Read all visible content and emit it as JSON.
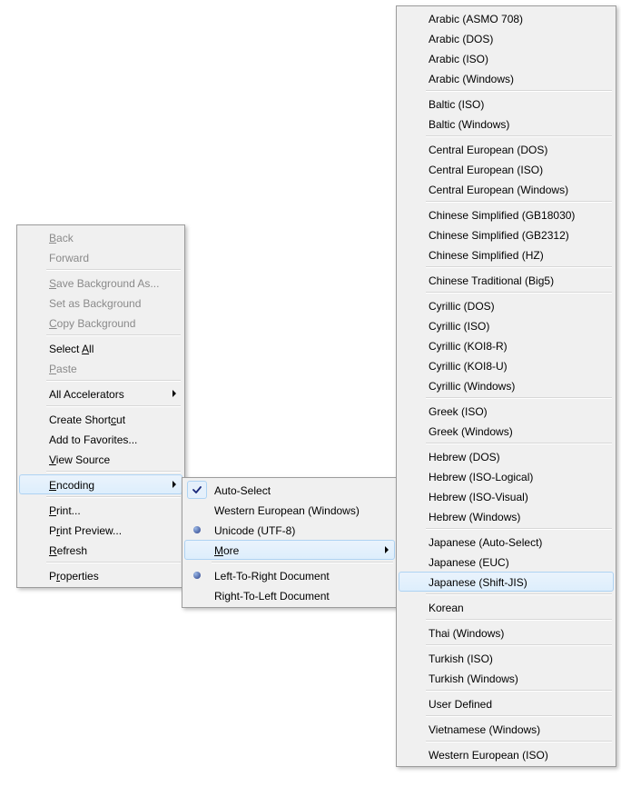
{
  "menu1": {
    "groups": [
      [
        {
          "label": "Back",
          "disabled": true,
          "u": 0
        },
        {
          "label": "Forward",
          "disabled": true
        }
      ],
      [
        {
          "label": "Save Background As...",
          "disabled": true,
          "u": 0
        },
        {
          "label": "Set as Background",
          "disabled": true
        },
        {
          "label": "Copy Background",
          "disabled": true,
          "u": 0
        }
      ],
      [
        {
          "label": "Select All",
          "u": 7
        },
        {
          "label": "Paste",
          "disabled": true,
          "u": 0
        }
      ],
      [
        {
          "label": "All Accelerators",
          "submenu": true
        }
      ],
      [
        {
          "label": "Create Shortcut",
          "u": 12
        },
        {
          "label": "Add to Favorites..."
        },
        {
          "label": "View Source",
          "u": 0
        }
      ],
      [
        {
          "label": "Encoding",
          "submenu": true,
          "highlight": true,
          "u": 0
        }
      ],
      [
        {
          "label": "Print...",
          "u": 0
        },
        {
          "label": "Print Preview...",
          "u": 1
        },
        {
          "label": "Refresh",
          "u": 0
        }
      ],
      [
        {
          "label": "Properties",
          "u": 1
        }
      ]
    ]
  },
  "menu2": {
    "groups": [
      [
        {
          "label": "Auto-Select",
          "check": true
        },
        {
          "label": "Western European (Windows)"
        },
        {
          "label": "Unicode (UTF-8)",
          "radio": true
        },
        {
          "label": "More",
          "submenu": true,
          "highlight": true,
          "u": 0
        }
      ],
      [
        {
          "label": "Left-To-Right Document",
          "radio": true
        },
        {
          "label": "Right-To-Left Document"
        }
      ]
    ]
  },
  "menu3": {
    "groups": [
      [
        {
          "label": "Arabic (ASMO 708)"
        },
        {
          "label": "Arabic (DOS)"
        },
        {
          "label": "Arabic (ISO)"
        },
        {
          "label": "Arabic (Windows)"
        }
      ],
      [
        {
          "label": "Baltic (ISO)"
        },
        {
          "label": "Baltic (Windows)"
        }
      ],
      [
        {
          "label": "Central European (DOS)"
        },
        {
          "label": "Central European (ISO)"
        },
        {
          "label": "Central European (Windows)"
        }
      ],
      [
        {
          "label": "Chinese Simplified (GB18030)"
        },
        {
          "label": "Chinese Simplified (GB2312)"
        },
        {
          "label": "Chinese Simplified (HZ)"
        }
      ],
      [
        {
          "label": "Chinese Traditional (Big5)"
        }
      ],
      [
        {
          "label": "Cyrillic (DOS)"
        },
        {
          "label": "Cyrillic (ISO)"
        },
        {
          "label": "Cyrillic (KOI8-R)"
        },
        {
          "label": "Cyrillic (KOI8-U)"
        },
        {
          "label": "Cyrillic (Windows)"
        }
      ],
      [
        {
          "label": "Greek (ISO)"
        },
        {
          "label": "Greek (Windows)"
        }
      ],
      [
        {
          "label": "Hebrew (DOS)"
        },
        {
          "label": "Hebrew (ISO-Logical)"
        },
        {
          "label": "Hebrew (ISO-Visual)"
        },
        {
          "label": "Hebrew (Windows)"
        }
      ],
      [
        {
          "label": "Japanese (Auto-Select)"
        },
        {
          "label": "Japanese (EUC)"
        },
        {
          "label": "Japanese (Shift-JIS)",
          "highlight": true
        }
      ],
      [
        {
          "label": "Korean"
        }
      ],
      [
        {
          "label": "Thai (Windows)"
        }
      ],
      [
        {
          "label": "Turkish (ISO)"
        },
        {
          "label": "Turkish (Windows)"
        }
      ],
      [
        {
          "label": "User Defined"
        }
      ],
      [
        {
          "label": "Vietnamese (Windows)"
        }
      ],
      [
        {
          "label": "Western European (ISO)"
        }
      ]
    ]
  }
}
